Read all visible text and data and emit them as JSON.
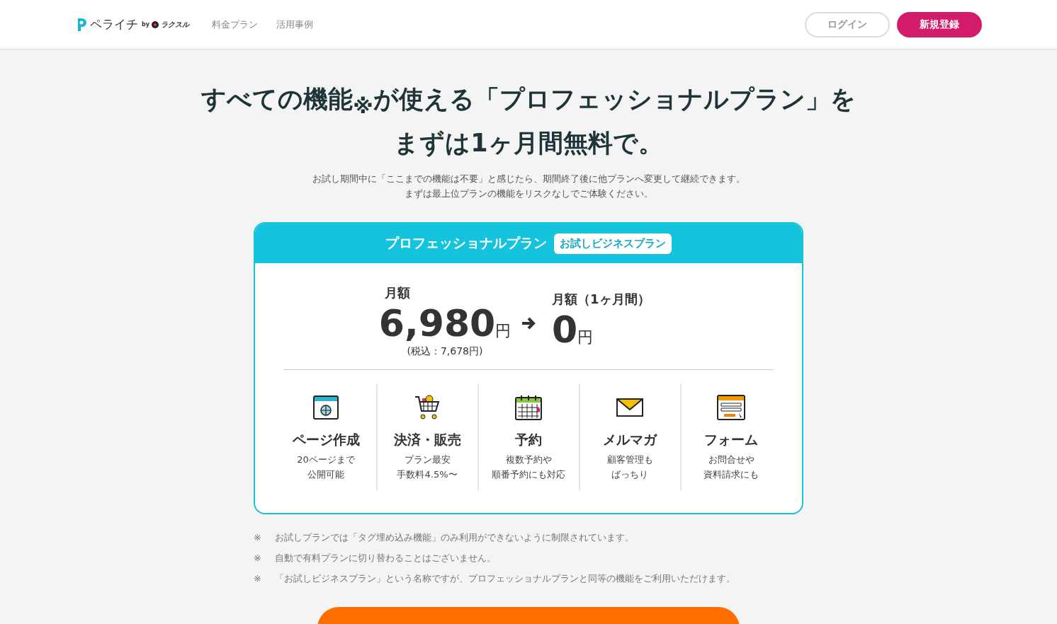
{
  "header": {
    "logo": {
      "name": "ペライチ",
      "by": "by",
      "brand": "ラクスル"
    },
    "nav": [
      "料金プラン",
      "活用事例"
    ],
    "login": "ログイン",
    "signup": "新規登録"
  },
  "hero": {
    "title_line_1": "すべての機能$_{※}$が使える「プロフェッショナルプラン」を",
    "title_line_2": "まずは1ヶ月間無料で。",
    "lead_1": "お試し期間中に「ここまでの機能は不要」と感じたら、期間終了後に他プランへ変更して継続できます。",
    "lead_2": "まずは最上位プランの機能をリスクなしでご体験ください。"
  },
  "plan_card": {
    "title": "プロフェッショナルプラン",
    "badge": "お試しビジネスプラン",
    "regular": {
      "label": "月額",
      "amount": "6,980",
      "unit": "円",
      "tax": "(税込：7,678円)"
    },
    "trial": {
      "label": "月額（1ヶ月間）",
      "amount": "0",
      "unit": "円"
    },
    "features": [
      {
        "kind": "browser",
        "title": "ページ作成",
        "lines": [
          "20ページまで",
          "公開可能"
        ]
      },
      {
        "kind": "cart",
        "title": "決済・販売",
        "lines": [
          "プラン最安",
          "手数料4.5%〜"
        ]
      },
      {
        "kind": "calendar",
        "title": "予約",
        "lines": [
          "複数予約や",
          "順番予約にも対応"
        ]
      },
      {
        "kind": "mail",
        "title": "メルマガ",
        "lines": [
          "顧客管理も",
          "ばっちり"
        ]
      },
      {
        "kind": "form",
        "title": "フォーム",
        "lines": [
          "お問合せや",
          "資料請求にも"
        ]
      }
    ]
  },
  "notes": [
    {
      "mark": "※",
      "text": "お試しプランでは「タグ埋め込み機能」のみ利用ができないように制限されています。"
    },
    {
      "mark": "※",
      "text": "自動で有料プランに切り替わることはございません。"
    },
    {
      "mark": "※",
      "text": "「お試しビジネスプラン」という名称ですが、プロフェッショナルプランと同等の機能をご利用いただけます。"
    }
  ]
}
